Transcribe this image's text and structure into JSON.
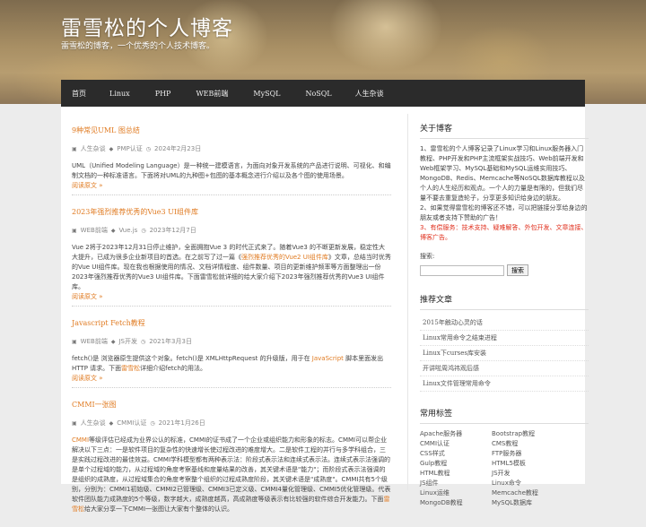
{
  "header": {
    "title": "雷雪松的个人博客",
    "subtitle": "雷雪松的博客，一个优秀的个人技术博客。"
  },
  "nav": {
    "items": [
      {
        "label": "首页"
      },
      {
        "label": "Linux"
      },
      {
        "label": "PHP"
      },
      {
        "label": "WEB前端"
      },
      {
        "label": "MySQL"
      },
      {
        "label": "NoSQL"
      },
      {
        "label": "人生杂谈"
      }
    ]
  },
  "posts": [
    {
      "title": "9种常见UML 图总结",
      "category": "人生杂谈",
      "tag": "PMP认证",
      "date": "2024年2月23日",
      "excerpt": "UML（Unified Modeling Language）是一种统一建模语言，为面向对象开发系统的产品进行说明、可视化、和编制文档的一种标准语言。下面将对UML的九种图+包图的基本概念进行介绍以及各个图的使用场景。",
      "more": "阅读原文 »"
    },
    {
      "title": "2023年强烈推荐优秀的Vue3 UI组件库",
      "category": "WEB前端",
      "tag": "Vue.js",
      "date": "2023年12月7日",
      "excerpt_a": "Vue 2将于2023年12月31日停止维护，全面拥抱Vue 3 的时代正式来了。随着Vue3 的不断更新发展，稳定性大大提升，已成为很多企业新项目的首选。在之前写了过一篇《",
      "excerpt_link": "强烈推荐优秀的Vue2 UI组件库",
      "excerpt_b": "》文章，总结当时优秀的Vue UI组件库。现在我也根据使用的情况、文档详情程度、组件数量、项目的更新维护频率等方面整理出一份2023年强烈推荐优秀的Vue3 UI组件库。下面雷雪松就详细的给大家介绍下2023年强烈推荐优秀的Vue3 UI组件库。",
      "more": "阅读原文 »"
    },
    {
      "title": "Javascript Fetch教程",
      "category": "WEB前端",
      "tag": "JS开发",
      "date": "2021年3月3日",
      "excerpt_a": "fetch()是 浏览器原生提供这个对象。fetch()是 XMLHttpRequest 的升级版，用于在 ",
      "excerpt_link": "JavaScript",
      "excerpt_b": " 脚本里面发出 HTTP 请求。下面",
      "excerpt_link2": "雷雪松",
      "excerpt_c": "详细介绍fetch的用法。",
      "more": "阅读原文 »"
    },
    {
      "title": "CMMI一张图",
      "category": "人生杂谈",
      "tag": "CMMI认证",
      "date": "2021年1月26日",
      "excerpt_link": "CMMI",
      "excerpt_a": "等级评估已经成为业界公认的标准，CMMI的证书成了一个企业或组织能力和形象的标志。CMMI可以帮企业解决以下三点：一是软件项目的复杂性的快速增长使过程改进的难度增大。二是软件工程的并行与多学科组合，三是实践过程改进的最佳效益。CMMI学科模型都有两种表示法：阶段式表示法和连续式表示法。连续式表示法强调的是单个过程域的能力，从过程域的角度考察基线和度量结果的改善，其关键术语是\"能力\"；而阶段式表示法强调的是组织的成熟度，从过程域集合的角度考察整个组织的过程成熟度阶段，其关键术语是\"成熟度\"。CMMI共有5个级别，分别为：CMMI1初始级、CMMI2已管理级、CMMI3已定义级、CMMI4量化管理级、CMMI5优化管理级。代表软件团队能力成熟度的5个等级，数字越大，成熟度越高，高成熟度等级表示有比较强的软件综合开发能力。下面",
      "excerpt_link2": "雷雪松",
      "excerpt_b": "给大家分享一下CMMI一张图让大家有个整体的认识。"
    }
  ],
  "sidebar": {
    "about": {
      "title": "关于博客",
      "p1": "1、雷雪松的个人博客记录了Linux学习和Linux服务器入门教程、PHP开发和PHP主流框架实战技巧、Web前端开发和Web框架学习、MySQL基础和MySQL运维实用技巧、MongoDB、Redis、Memcache等NoSQL数据库教程以及个人的人生经历和观点。一个人的力量是有限的，但我们尽量不要去重复造轮子，分享更多知识给身边的朋友。",
      "p2": "2、如果觉得雷雪松的博客还不错，可以把链接分享给身边的朋友或者支持下赞助的广告！",
      "p3": "3、有偿服务：技术支持、疑难解答、外包开发、文章连接、博客广告。"
    },
    "search": {
      "label": "搜索:",
      "placeholder": "",
      "button": "搜索"
    },
    "recommended": {
      "title": "推荐文章",
      "items": [
        "2015年触动心灵的话",
        "Linux常用命令之结束进程",
        "Linux下curses库安装",
        "开讲啦周鸿祎观后感",
        "Linux文件管理常用命令"
      ]
    },
    "tags": {
      "title": "常用标签",
      "items": [
        "Apache服务器",
        "Bootstrap教程",
        "CMMI认证",
        "CMS教程",
        "CSS样式",
        "FTP服务器",
        "Gulp教程",
        "HTML5模板",
        "HTML教程",
        "JS开发",
        "JS组件",
        "Linux命令",
        "Linux运维",
        "Memcache教程",
        "MongoDB教程",
        "MySQL数据库"
      ]
    }
  },
  "colors": {
    "accent": "#e07b22",
    "nav_bg": "#2b2b2b",
    "red": "#e0301e"
  }
}
